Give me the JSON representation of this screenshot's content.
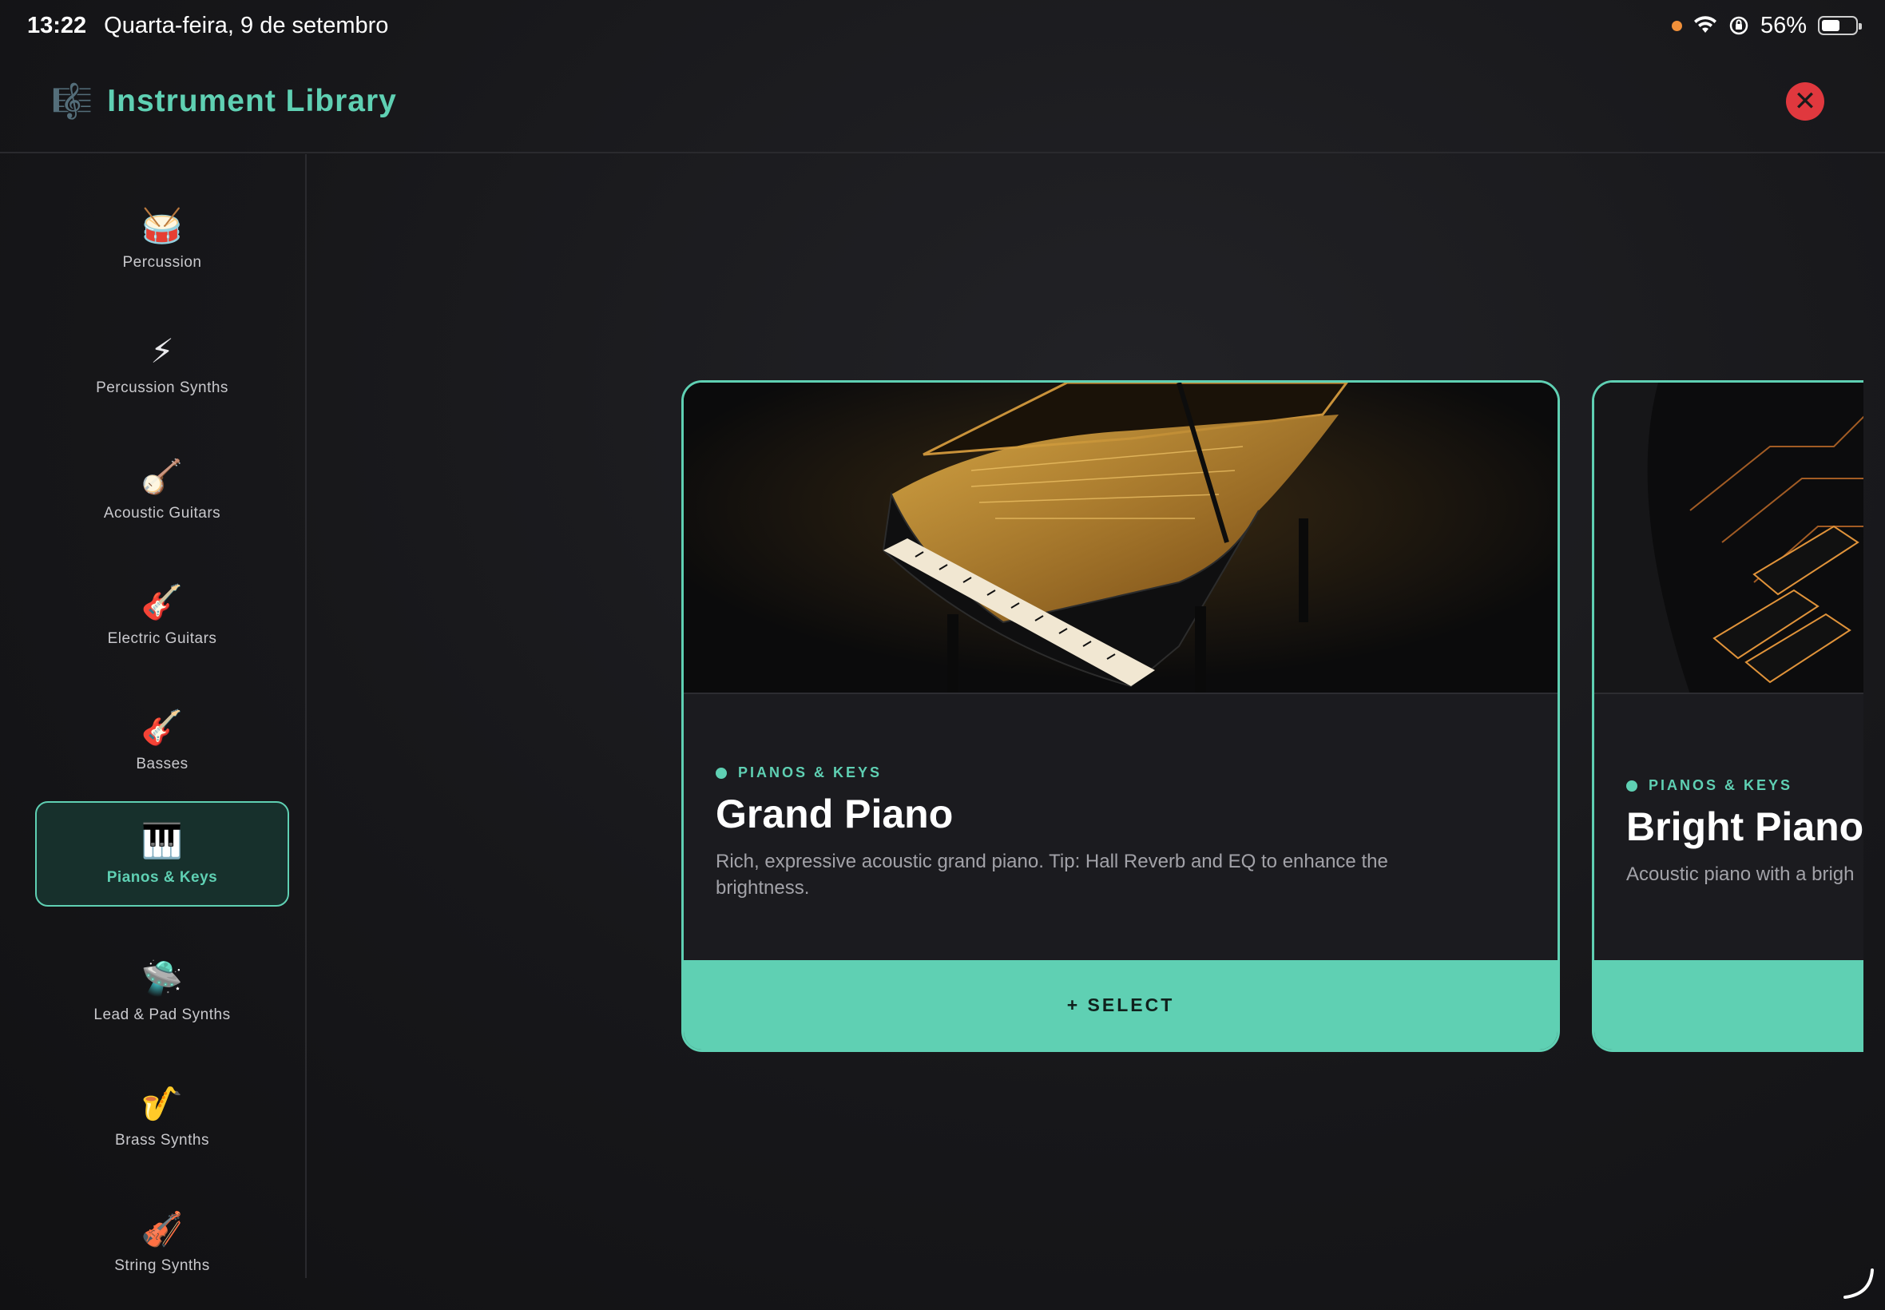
{
  "status": {
    "time": "13:22",
    "date": "Quarta-feira, 9 de setembro",
    "battery": "56%",
    "battery_level": 0.56
  },
  "header": {
    "title": "Instrument Library",
    "icon": "music-sheet-icon"
  },
  "sidebar": {
    "items": [
      {
        "label": "Percussion",
        "icon": "🥁"
      },
      {
        "label": "Percussion Synths",
        "icon": "⚡"
      },
      {
        "label": "Acoustic Guitars",
        "icon": "🪕"
      },
      {
        "label": "Electric Guitars",
        "icon": "🎸"
      },
      {
        "label": "Basses",
        "icon": "🎸"
      },
      {
        "label": "Pianos & Keys",
        "icon": "🎹",
        "active": true
      },
      {
        "label": "Lead & Pad Synths",
        "icon": "🛸"
      },
      {
        "label": "Brass Synths",
        "icon": "🎷"
      },
      {
        "label": "String Synths",
        "icon": "🎻"
      }
    ]
  },
  "cards": [
    {
      "category": "PIANOS & KEYS",
      "title": "Grand Piano",
      "description": "Rich, expressive acoustic grand piano. Tip: Hall Reverb and EQ to enhance the brightness.",
      "select_label": "+ SELECT"
    },
    {
      "category": "PIANOS & KEYS",
      "title": "Bright Piano",
      "description": "Acoustic piano with a brigh"
    }
  ],
  "colors": {
    "accent": "#5fd0b3",
    "close": "#e0383e",
    "background": "#17171a"
  }
}
